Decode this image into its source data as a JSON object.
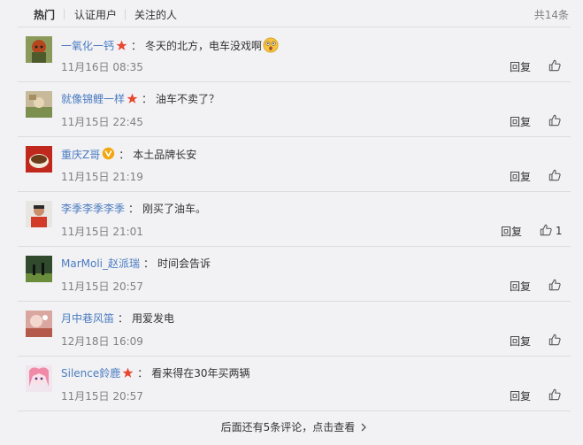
{
  "tabs": [
    {
      "label": "热门",
      "active": true
    },
    {
      "label": "认证用户",
      "active": false
    },
    {
      "label": "关注的人",
      "active": false
    }
  ],
  "total_count": "共14条",
  "comments": [
    {
      "user": "一氧化一钙",
      "badge": "star",
      "text": "冬天的北方，电车没戏啊",
      "emoji": "astonished-emoji",
      "time": "11月16日 08:35",
      "reply": "回复",
      "likes": ""
    },
    {
      "user": "就像锦鲤一样",
      "badge": "star",
      "text": "油车不卖了？",
      "time": "11月15日 22:45",
      "reply": "回复",
      "likes": ""
    },
    {
      "user": "重庆Z哥",
      "badge": "verified",
      "text": "本土品牌长安",
      "time": "11月15日 21:19",
      "reply": "回复",
      "likes": ""
    },
    {
      "user": "李季李季李季",
      "badge": "",
      "text": "刚买了油车。",
      "time": "11月15日 21:01",
      "reply": "回复",
      "likes": "1"
    },
    {
      "user": "MarMoli_赵派瑞",
      "badge": "",
      "text": "时间会告诉",
      "time": "11月15日 20:57",
      "reply": "回复",
      "likes": ""
    },
    {
      "user": "月中巷风笛",
      "badge": "",
      "text": "用爱发电",
      "time": "12月18日 16:09",
      "reply": "回复",
      "likes": ""
    },
    {
      "user": "Silence鈴鹿",
      "badge": "star",
      "text": "看来得在30年买两辆",
      "time": "11月15日 20:57",
      "reply": "回复",
      "likes": ""
    }
  ],
  "more_link": "后面还有5条评论，点击查看",
  "colors": {
    "link": "#4a7bbf",
    "star": "#e8462e",
    "verified": "#f2a60f",
    "muted": "#808080"
  }
}
